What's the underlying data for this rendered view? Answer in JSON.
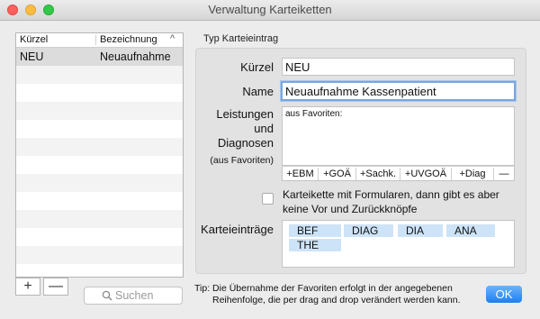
{
  "window": {
    "title": "Verwaltung Karteiketten"
  },
  "list": {
    "headers": {
      "kuerzel": "Kürzel",
      "bezeichnung": "Bezeichnung",
      "sort_glyph": "^"
    },
    "rows": [
      {
        "kuerzel": "NEU",
        "bezeichnung": "Neuaufnahme"
      }
    ]
  },
  "list_controls": {
    "add": "+",
    "remove": "—"
  },
  "search": {
    "placeholder": "Suchen",
    "icon": "search-icon"
  },
  "form": {
    "group_title": "Typ Karteieintrag",
    "kuerzel_label": "Kürzel",
    "kuerzel_value": "NEU",
    "name_label": "Name",
    "name_value": "Neuaufnahme Kassenpatient",
    "leist_label_1": "Leistungen",
    "leist_label_2": "und",
    "leist_label_3": "Diagnosen",
    "leist_label_4": "(aus Favoriten)",
    "favoriten_header": "aus Favoriten:",
    "fav_buttons": [
      "+EBM",
      "+GOÄ",
      "+Sachk.",
      "+UVGOÄ",
      "+Diag",
      "—"
    ],
    "checkbox_label": "Karteikette mit Formularen, dann gibt es aber keine Vor und Zurückknöpfe",
    "checkbox_checked": false,
    "eintraege_label": "Karteieinträge",
    "eintraege": [
      "BEF",
      "DIAG",
      "DIA",
      "ANA",
      "THE"
    ]
  },
  "footer": {
    "tip_label": "Tip:",
    "tip_line1": "Die Übernahme der Favoriten erfolgt in der angegebenen",
    "tip_line2": "Reihenfolge, die per drag and drop verändert werden kann.",
    "ok_label": "OK"
  },
  "colors": {
    "accent": "#1f7ff0",
    "chip": "#cde3f7",
    "selected_row": "#dcdcdc"
  }
}
